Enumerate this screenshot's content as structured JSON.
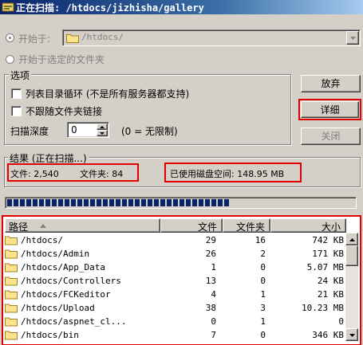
{
  "window": {
    "title": "正在扫描: /htdocs/jizhisha/gallery"
  },
  "start_at": {
    "radio_label": "开始于:",
    "path_value": "/htdocs/"
  },
  "start_selected_label": "开始于选定的文件夹",
  "options": {
    "group_label": "选项",
    "list_loop_label": "列表目录循环 (不是所有服务器都支持)",
    "no_follow_links_label": "不跟随文件夹链接",
    "depth_label": "扫描深度",
    "depth_value": "0",
    "depth_hint": "(0 = 无限制)"
  },
  "buttons": {
    "abort": "放弃",
    "details": "详细",
    "close": "关闭"
  },
  "result": {
    "group_label": "结果 (正在扫描...)",
    "files_text": "文件: 2,540",
    "folders_text": "文件夹: 84",
    "disk_used_text": "已使用磁盘空间: 148.95 MB"
  },
  "progress": {
    "blocks": 35
  },
  "table": {
    "columns": [
      "路径",
      "文件",
      "文件夹",
      "大小"
    ],
    "rows": [
      {
        "path": "/htdocs/",
        "files": "29",
        "folders": "16",
        "size": "742 KB"
      },
      {
        "path": "/htdocs/Admin",
        "files": "26",
        "folders": "2",
        "size": "171 KB"
      },
      {
        "path": "/htdocs/App_Data",
        "files": "1",
        "folders": "0",
        "size": "5.07 MB"
      },
      {
        "path": "/htdocs/Controllers",
        "files": "13",
        "folders": "0",
        "size": "24 KB"
      },
      {
        "path": "/htdocs/FCKeditor",
        "files": "4",
        "folders": "1",
        "size": "21 KB"
      },
      {
        "path": "/htdocs/Upload",
        "files": "38",
        "folders": "3",
        "size": "10.23 MB"
      },
      {
        "path": "/htdocs/aspnet_cl...",
        "files": "0",
        "folders": "1",
        "size": "0"
      },
      {
        "path": "/htdocs/bin",
        "files": "7",
        "folders": "0",
        "size": "346 KB"
      }
    ]
  },
  "colors": {
    "highlight": "#e00000",
    "titlebar": "#0a246a",
    "progress": "#0a246a"
  }
}
